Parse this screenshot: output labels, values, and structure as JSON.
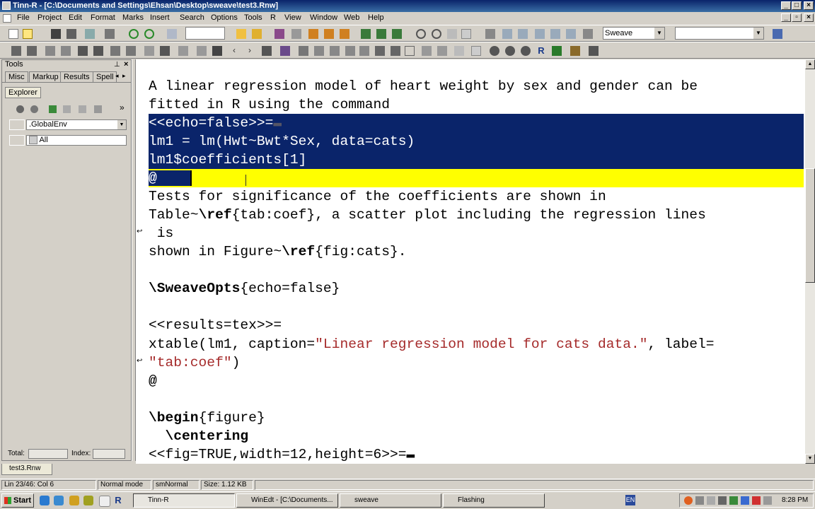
{
  "window": {
    "title": "Tinn-R - [C:\\Documents and Settings\\Ehsan\\Desktop\\sweave\\test3.Rnw]"
  },
  "menu": [
    "File",
    "Project",
    "Edit",
    "Format",
    "Marks",
    "Insert",
    "Search",
    "Options",
    "Tools",
    "R",
    "View",
    "Window",
    "Web",
    "Help"
  ],
  "toolbar": {
    "filter_combo": "Sweave",
    "second_combo": ""
  },
  "left_panel": {
    "title": "Tools",
    "tabs": [
      "Misc",
      "Markup",
      "Results",
      "Spell"
    ],
    "explorer_tab": "Explorer",
    "env_combo": ".GlobalEnv",
    "filter_combo": "All",
    "total_label": "Total:",
    "index_label": "Index:"
  },
  "editor": {
    "lines": {
      "l1": "A linear regression model of heart weight by sex and gender can be",
      "l2": "fitted in R using the command",
      "l3": "<<echo=false>>=",
      "l4": "lm1 = lm(Hwt~Bwt*Sex, data=cats)",
      "l5": "lm1$coefficients[1]",
      "l6": "@",
      "l7": "Tests for significance of the coefficients are shown in",
      "l8a": "Table~",
      "l8b": "\\ref",
      "l8c": "{tab:coef}, a scatter plot including the regression lines",
      "l9": " is",
      "l10a": "shown in Figure~",
      "l10b": "\\ref",
      "l10c": "{fig:cats}.",
      "l12a": "\\SweaveOpts",
      "l12b": "{echo=false}",
      "l14": "<<results=tex>>=",
      "l15a": "xtable(lm1, caption=",
      "l15b": "\"Linear regression model for cats data.\"",
      "l15c": ", label=",
      "l16a": "\"tab:coef\"",
      "l16b": ")",
      "l17": "@",
      "l19a": "\\begin",
      "l19b": "{figure}",
      "l20": "  \\centering",
      "l21": "<<fig=TRUE,width=12,height=6>>="
    }
  },
  "doc_tab": "test3.Rnw",
  "status": {
    "position": "Lin 23/46: Col 6",
    "mode": "Normal mode",
    "syntax": "smNormal",
    "size": "Size: 1.12 KB"
  },
  "taskbar": {
    "start": "Start",
    "tasks": [
      "Tinn-R",
      "WinEdt - [C:\\Documents...",
      "sweave",
      "Flashing"
    ],
    "lang": "EN",
    "clock": "8:28 PM"
  }
}
